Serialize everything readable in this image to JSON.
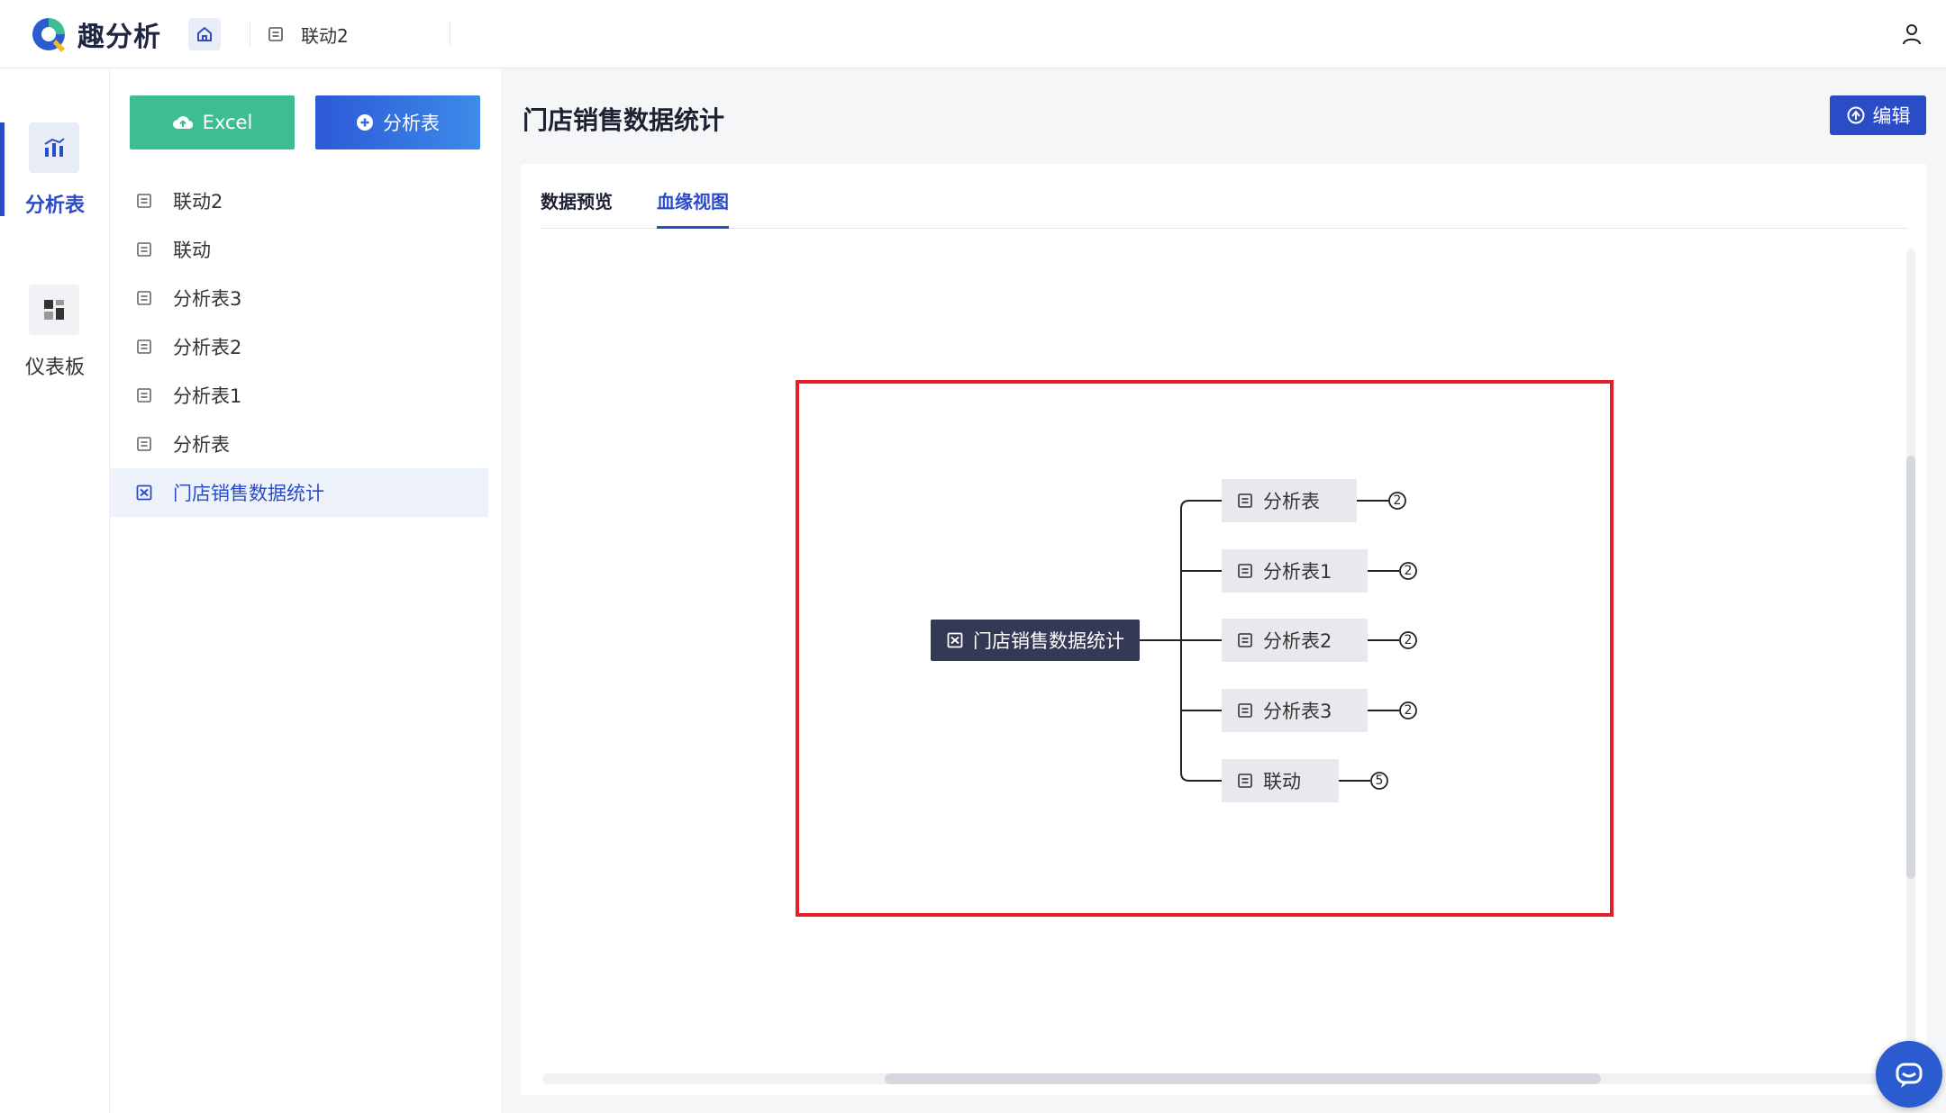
{
  "app": {
    "name": "趣分析"
  },
  "breadcrumb": {
    "current": "联动2"
  },
  "nav": {
    "items": [
      {
        "label": "分析表",
        "icon": "chart-icon",
        "active": true
      },
      {
        "label": "仪表板",
        "icon": "dashboard-icon",
        "active": false
      }
    ]
  },
  "sidebar": {
    "excel_button": "Excel",
    "add_button": "分析表",
    "items": [
      {
        "label": "联动2"
      },
      {
        "label": "联动"
      },
      {
        "label": "分析表3"
      },
      {
        "label": "分析表2"
      },
      {
        "label": "分析表1"
      },
      {
        "label": "分析表"
      },
      {
        "label": "门店销售数据统计",
        "active": true
      }
    ]
  },
  "main": {
    "title": "门店销售数据统计",
    "edit_button": "编辑",
    "tabs": [
      {
        "label": "数据预览",
        "active": false
      },
      {
        "label": "血缘视图",
        "active": true
      }
    ]
  },
  "lineage": {
    "root": "门店销售数据统计",
    "children": [
      {
        "label": "分析表",
        "count": "2"
      },
      {
        "label": "分析表1",
        "count": "2"
      },
      {
        "label": "分析表2",
        "count": "2"
      },
      {
        "label": "分析表3",
        "count": "2"
      },
      {
        "label": "联动",
        "count": "5"
      }
    ]
  },
  "colors": {
    "primary": "#2b4cc7",
    "excel_green": "#3ebc93",
    "root_node": "#343a55",
    "child_node": "#e8e9ed",
    "highlight_red": "#e3202a"
  }
}
